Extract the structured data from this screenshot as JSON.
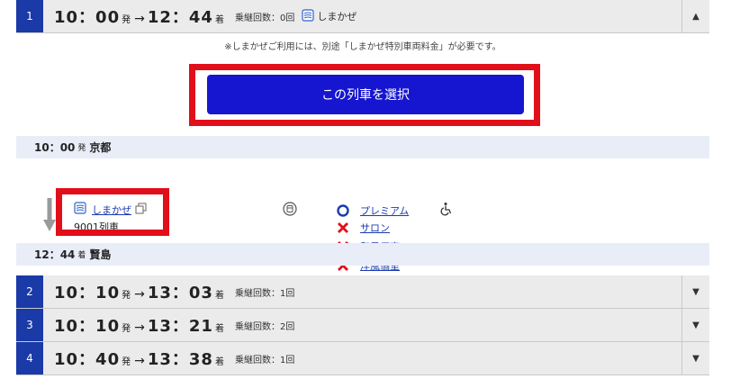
{
  "routes": [
    {
      "num": "1",
      "dep_time": "10：00",
      "dep_suffix": "発",
      "arrow": "→",
      "arr_time": "12：44",
      "arr_suffix": "着",
      "transfers": "乗継回数：0回",
      "train_tag": "しまかぜ",
      "toggle": "▲",
      "expanded": true
    },
    {
      "num": "2",
      "dep_time": "10：10",
      "dep_suffix": "発",
      "arrow": "→",
      "arr_time": "13：03",
      "arr_suffix": "着",
      "transfers": "乗継回数：1回",
      "toggle": "▼"
    },
    {
      "num": "3",
      "dep_time": "10：10",
      "dep_suffix": "発",
      "arrow": "→",
      "arr_time": "13：21",
      "arr_suffix": "着",
      "transfers": "乗継回数：2回",
      "toggle": "▼"
    },
    {
      "num": "4",
      "dep_time": "10：40",
      "dep_suffix": "発",
      "arrow": "→",
      "arr_time": "13：38",
      "arr_suffix": "着",
      "transfers": "乗継回数：1回",
      "toggle": "▼"
    }
  ],
  "detail": {
    "note": "※しまかぜご利用には、別途「しまかぜ特別車両料金」が必要です。",
    "select_label": "この列車を選択",
    "departure": {
      "time": "10：00",
      "suffix": "発",
      "station": "京都"
    },
    "arrival": {
      "time": "12：44",
      "suffix": "着",
      "station": "賢島"
    },
    "train": {
      "name": "しまかぜ",
      "number": "9001列車"
    },
    "facilities": [
      {
        "status": "available",
        "label": "プレミアム"
      },
      {
        "status": "unavailable",
        "label": "サロン"
      },
      {
        "status": "unavailable",
        "label": "和風個室"
      },
      {
        "status": "unavailable",
        "label": "洋風個室"
      }
    ]
  },
  "icons": {
    "train_icon": "train-icon",
    "window_icon": "new-window-icon",
    "food_icon": "food-service-icon",
    "wheelchair_icon": "wheelchair-icon",
    "circle_icon": "available-circle-icon",
    "cross_icon": "unavailable-cross-icon"
  },
  "colors": {
    "accent_blue": "#1a3aa8",
    "button_blue": "#1616d0",
    "highlight_red": "#e10f1a",
    "station_bar": "#e9edf8",
    "header_gray": "#ebebeb",
    "link_blue": "#1b3bb1"
  }
}
